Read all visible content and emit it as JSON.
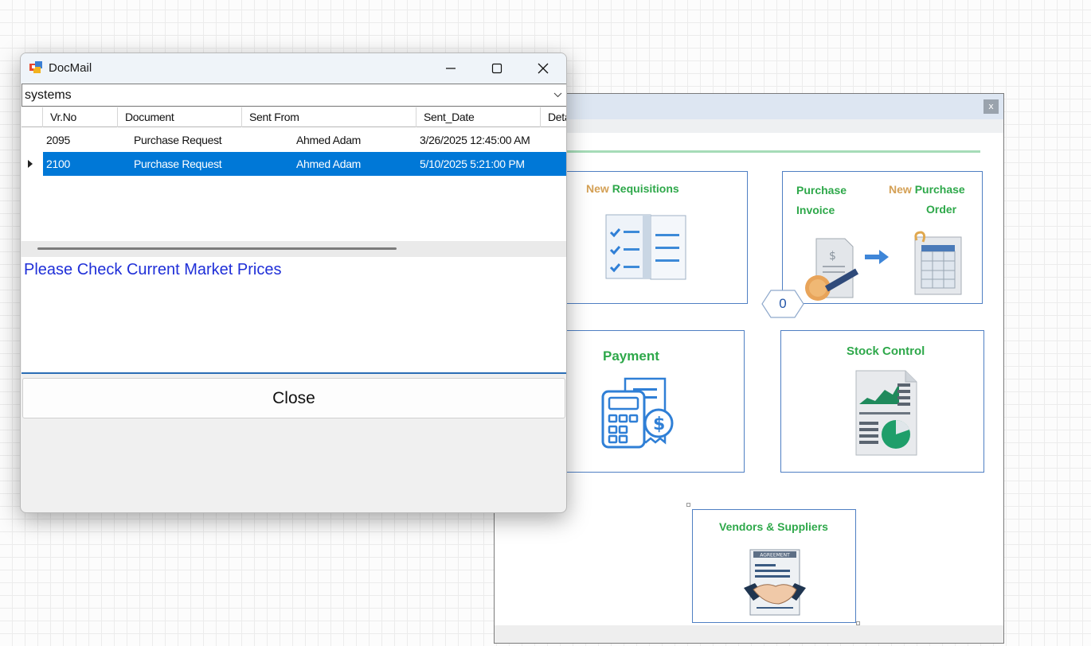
{
  "dialog": {
    "title": "DocMail",
    "combo_value": "systems",
    "columns": [
      "Vr.No",
      "Document",
      "Sent From",
      "Sent_Date",
      "Deta"
    ],
    "rows": [
      {
        "vr_no": "2095",
        "document": "Purchase Request",
        "sent_from": "Ahmed Adam",
        "sent_date": "3/26/2025 12:45:00 AM",
        "selected": false
      },
      {
        "vr_no": "2100",
        "document": "Purchase Request",
        "sent_from": "Ahmed Adam",
        "sent_date": "5/10/2025 5:21:00 PM",
        "selected": true
      }
    ],
    "message": "Please Check Current Market Prices",
    "close_label": "Close"
  },
  "menu": {
    "close_glyph": "x",
    "tiles": {
      "new_requisitions": {
        "prefix": "New",
        "label": "Requisitions",
        "icon": "checklist-documents-icon"
      },
      "purchase_invoice": {
        "line1": "Purchase",
        "line2": "Invoice",
        "icon": "invoice-payment-icon"
      },
      "new_purchase_order": {
        "prefix": "New",
        "line1": "Purchase",
        "line2": "Order",
        "icon": "order-sheet-icon"
      },
      "payment": {
        "label": "Payment",
        "icon": "calculator-receipt-icon"
      },
      "stock_control": {
        "label": "Stock Control",
        "icon": "report-chart-icon"
      },
      "vendors_suppliers": {
        "label": "Vendors & Suppliers",
        "agreement": "AGREEMENT",
        "icon": "handshake-agreement-icon"
      }
    },
    "counter": "0"
  },
  "colors": {
    "selection": "#0078d7",
    "tile_border": "#4f7fc3",
    "tile_green": "#2ea84a",
    "tile_orange": "#d4a055",
    "message_blue": "#1f2fd8"
  }
}
